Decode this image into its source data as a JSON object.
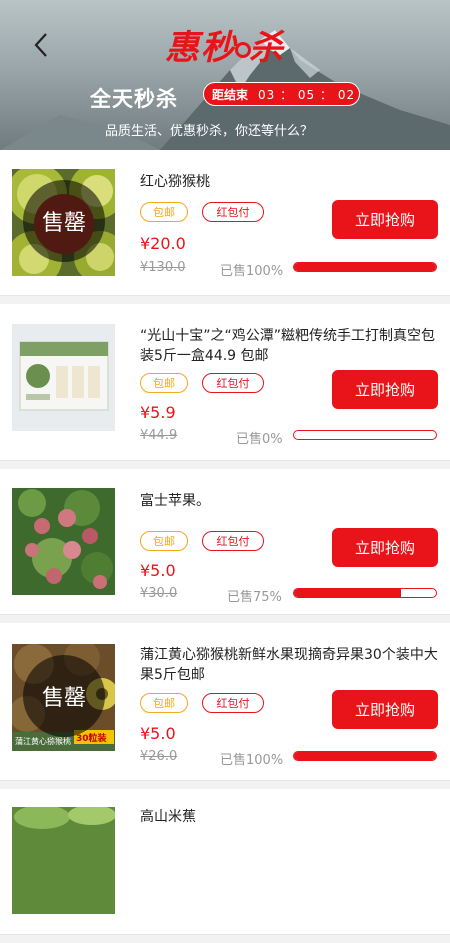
{
  "header": {
    "logo_text_1": "惠",
    "logo_text_2": "秒",
    "logo_text_3": "杀",
    "title": "全天秒杀",
    "countdown_label": "距结束",
    "countdown_time": "03 ： 05 ： 02",
    "slogan": "品质生活、优惠秒杀，你还等什么？"
  },
  "colors": {
    "accent": "#e8141a",
    "tag_orange": "#f5a623"
  },
  "buy_label": "立即抢购",
  "products": [
    {
      "name": "红心猕猴桃",
      "tag1": "包邮",
      "tag2": "红包付",
      "price": "¥20.0",
      "original_price": "¥130.0",
      "sold_text": "已售100%",
      "progress": 1.0,
      "overlay": "售罄",
      "image": "kiwi-image"
    },
    {
      "name": "“光山十宝”之“鸡公潭”糍粑传统手工打制真空包装5斤一盒44.9  包邮",
      "tag1": "包邮",
      "tag2": "红包付",
      "price": "¥5.9",
      "original_price": "¥44.9",
      "sold_text": "已售0%",
      "progress": 0.0,
      "overlay": "",
      "image": "ciba-box-image"
    },
    {
      "name": "富士苹果。",
      "tag1": "包邮",
      "tag2": "红包付",
      "price": "¥5.0",
      "original_price": "¥30.0",
      "sold_text": "已售75%",
      "progress": 0.75,
      "overlay": "",
      "image": "apple-tree-image"
    },
    {
      "name": "蒲江黄心猕猴桃新鲜水果现摘奇异果30个装中大果5斤包邮",
      "tag1": "包邮",
      "tag2": "红包付",
      "price": "¥5.0",
      "original_price": "¥26.0",
      "sold_text": "已售100%",
      "progress": 1.0,
      "overlay": "售罄",
      "image": "yellow-kiwi-image",
      "image_caption": "蒲江黄心猕猴桃",
      "image_badge": "30粒装"
    },
    {
      "name": "高山米蕉",
      "image": "banana-image"
    }
  ]
}
